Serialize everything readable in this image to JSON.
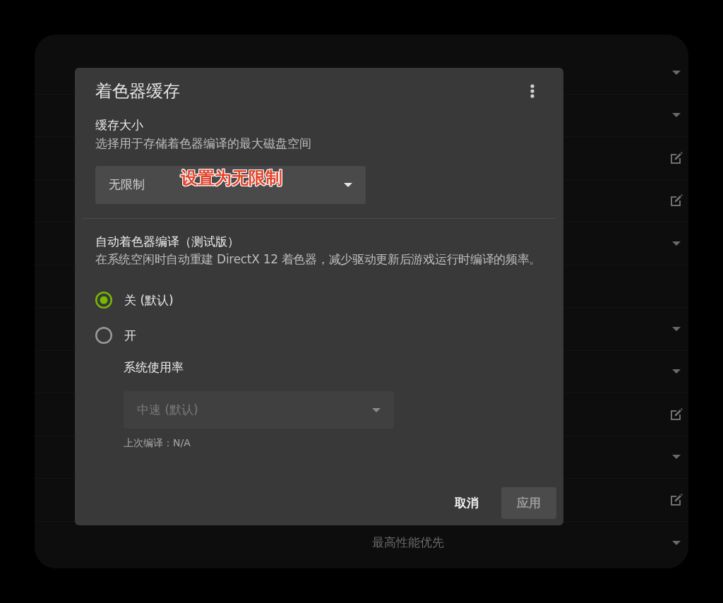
{
  "background": {
    "rows": [
      {
        "kind": "dropdown"
      },
      {
        "kind": "dropdown"
      },
      {
        "kind": "edit"
      },
      {
        "kind": "edit"
      },
      {
        "kind": "dropdown"
      },
      {
        "kind": "none"
      },
      {
        "kind": "dropdown"
      },
      {
        "kind": "dropdown"
      },
      {
        "kind": "edit"
      },
      {
        "kind": "dropdown"
      },
      {
        "kind": "edit"
      },
      {
        "kind": "dropdown",
        "value": "最高性能优先"
      }
    ]
  },
  "dialog": {
    "title": "着色器缓存",
    "cache_size": {
      "label": "缓存大小",
      "description": "选择用于存储着色器编译的最大磁盘空间",
      "dropdown": {
        "value": "无限制",
        "disabled": false
      },
      "annotation": "设置为无限制"
    },
    "auto_compile": {
      "label": "自动着色器编译（测试版）",
      "description": "在系统空闲时自动重建 DirectX 12 着色器，减少驱动更新后游戏运行时编译的频率。",
      "options": [
        {
          "label": "关 (默认)",
          "selected": true
        },
        {
          "label": "开",
          "selected": false
        }
      ],
      "usage": {
        "label": "系统使用率",
        "dropdown": {
          "value": "中速 (默认)",
          "disabled": true
        },
        "last_compile": "上次编译：N/A"
      }
    },
    "buttons": [
      {
        "label": "取消",
        "kind": "text",
        "disabled": false
      },
      {
        "label": "应用",
        "kind": "filled",
        "disabled": true
      }
    ]
  }
}
